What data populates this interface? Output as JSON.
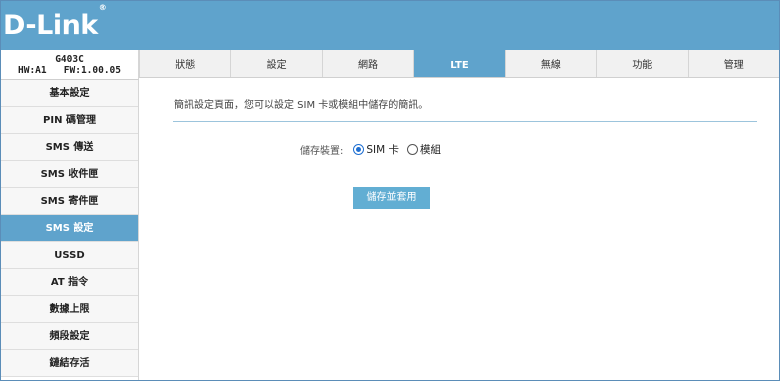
{
  "brand": {
    "logo": "D-Link",
    "trademark": "®"
  },
  "device": {
    "model": "G403C",
    "hw": "HW:A1",
    "fw": "FW:1.00.05"
  },
  "tabs": [
    {
      "label": "狀態"
    },
    {
      "label": "設定"
    },
    {
      "label": "網路"
    },
    {
      "label": "LTE",
      "active": true
    },
    {
      "label": "無線"
    },
    {
      "label": "功能"
    },
    {
      "label": "管理"
    }
  ],
  "sidebar": {
    "items": [
      {
        "label": "基本設定"
      },
      {
        "label": "PIN 碼管理"
      },
      {
        "label": "SMS 傳送"
      },
      {
        "label": "SMS 收件匣"
      },
      {
        "label": "SMS 寄件匣"
      },
      {
        "label": "SMS 設定",
        "active": true
      },
      {
        "label": "USSD"
      },
      {
        "label": "AT 指令"
      },
      {
        "label": "數據上限"
      },
      {
        "label": "頻段設定"
      },
      {
        "label": "鏈結存活"
      }
    ]
  },
  "main": {
    "description": "簡訊設定頁面，您可以設定 SIM 卡或模組中儲存的簡訊。",
    "storage_label": "儲存裝置:",
    "options": [
      {
        "label": "SIM 卡",
        "checked": true
      },
      {
        "label": "模組",
        "checked": false
      }
    ],
    "save_button": "儲存並套用"
  },
  "colors": {
    "accent": "#5fa3cc",
    "radio_selected": "#1f6fd1"
  }
}
